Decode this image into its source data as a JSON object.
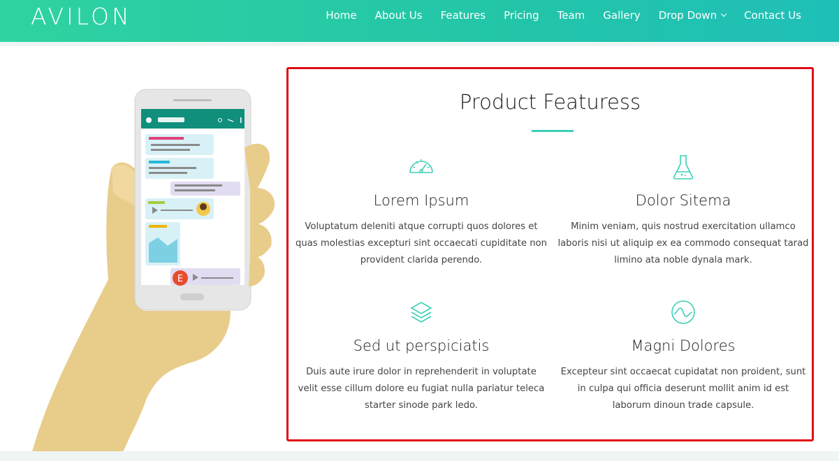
{
  "brand": {
    "logo": "AVILON"
  },
  "nav": {
    "items": [
      "Home",
      "About Us",
      "Features",
      "Pricing",
      "Team",
      "Gallery",
      "Drop Down",
      "Contact Us"
    ]
  },
  "illustration": {
    "avatar_letter": "E"
  },
  "features_section": {
    "title": "Product Featuress",
    "features": [
      {
        "icon": "speedometer-icon",
        "heading": "Lorem Ipsum",
        "description": "Voluptatum deleniti atque corrupti quos dolores et quas molestias excepturi sint occaecati cupiditate non provident clarida perendo."
      },
      {
        "icon": "flask-icon",
        "heading": "Dolor Sitema",
        "description": "Minim veniam, quis nostrud exercitation ullamco laboris nisi ut aliquip ex ea commodo consequat tarad limino ata noble dynala mark."
      },
      {
        "icon": "layers-icon",
        "heading": "Sed ut perspiciatis",
        "description": "Duis aute irure dolor in reprehenderit in voluptate velit esse cillum dolore eu fugiat nulla pariatur teleca starter sinode park ledo."
      },
      {
        "icon": "pulse-circle-icon",
        "heading": "Magni Dolores",
        "description": "Excepteur sint occaecat cupidatat non proident, sunt in culpa qui officia deserunt mollit anim id est laborum dinoun trade capsule."
      }
    ]
  },
  "colors": {
    "header_gradient_start": "#2fd3a0",
    "header_gradient_end": "#1fbfb8",
    "accent": "#3ccfb5",
    "highlight_border": "#e00d16",
    "hand": "#e8cc8a",
    "phone_header": "#0f8f7c"
  }
}
